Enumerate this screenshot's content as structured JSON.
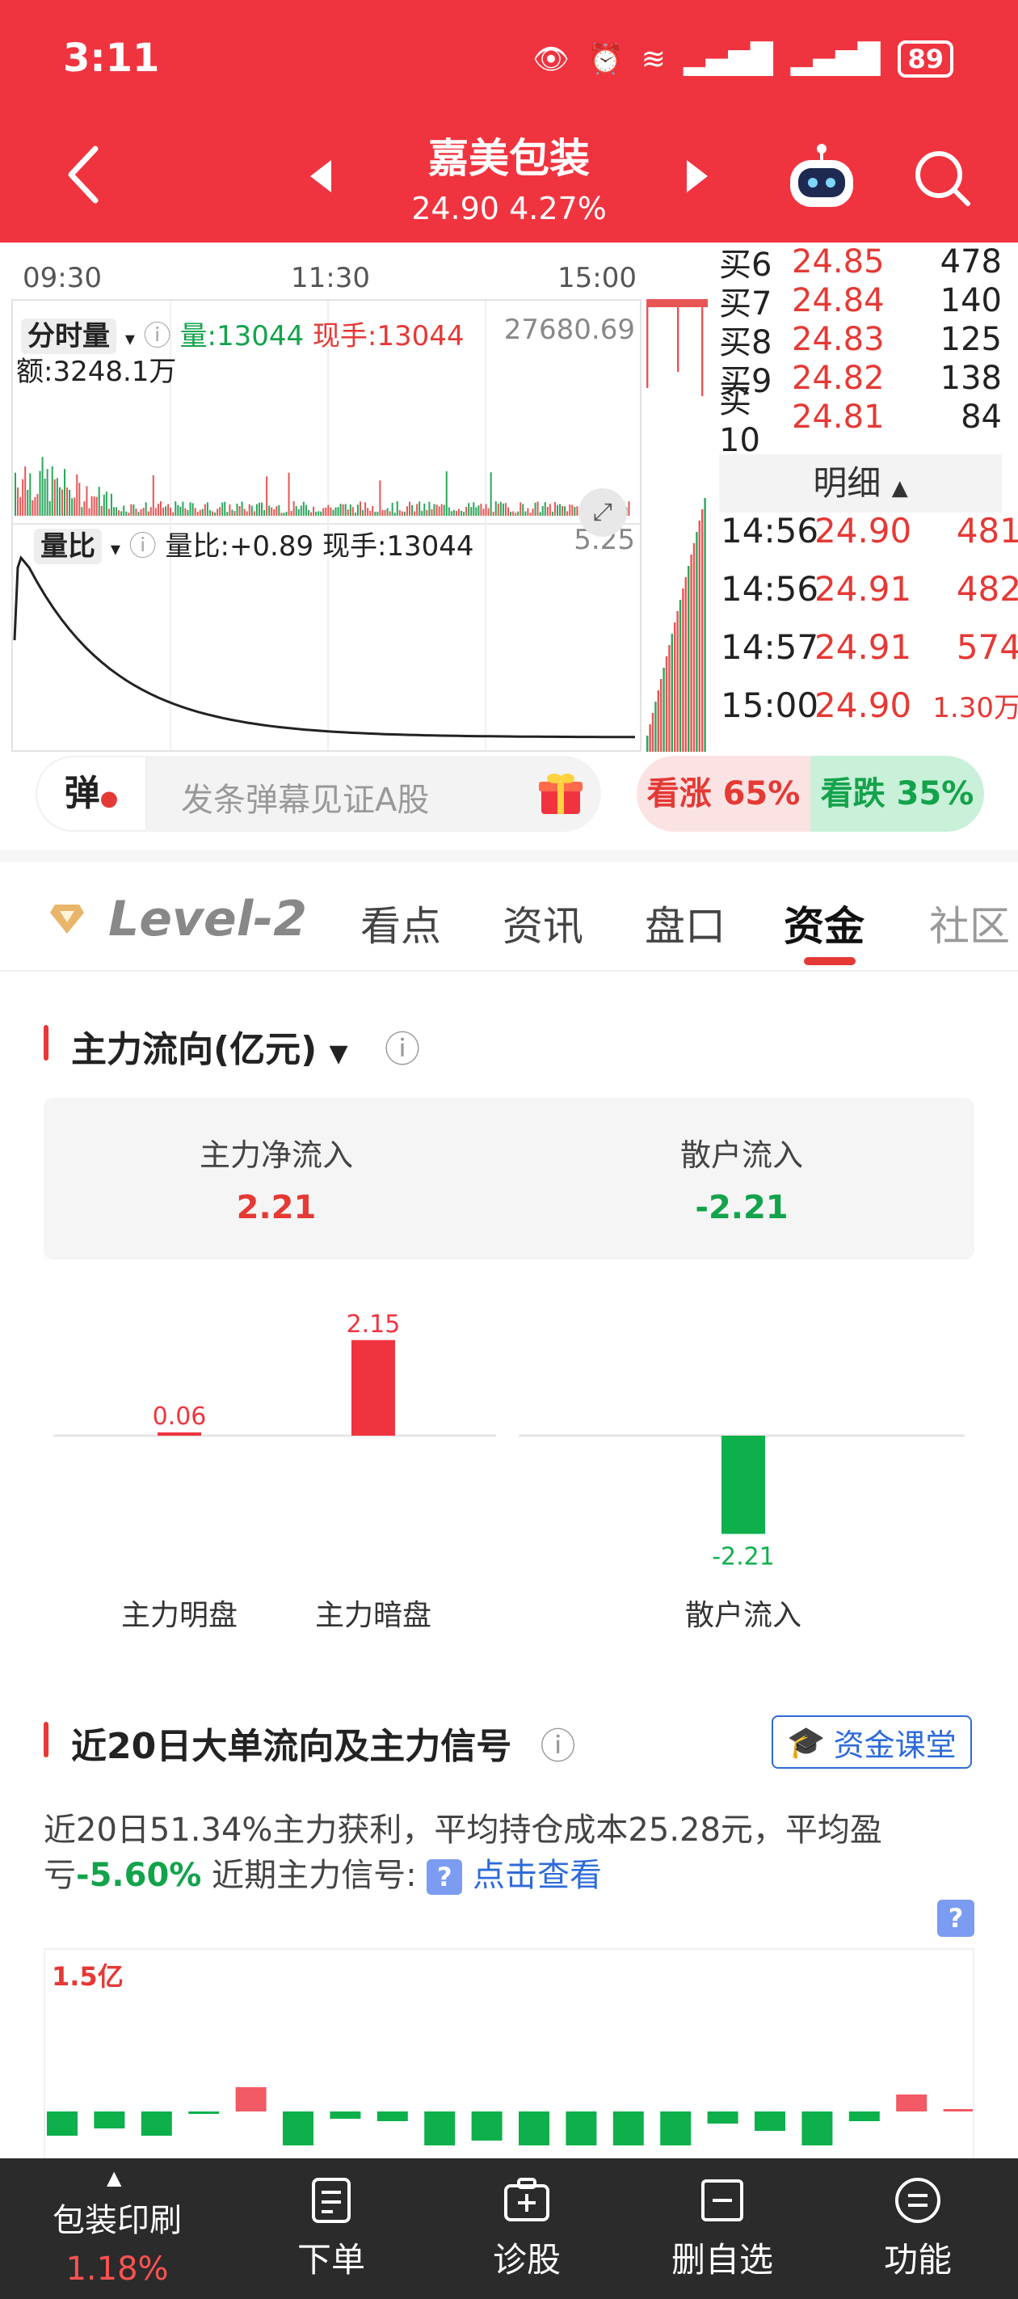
{
  "status": {
    "time": "3:11",
    "battery": "89"
  },
  "header": {
    "stock_name": "嘉美包装",
    "price": "24.90",
    "change_pct": "4.27%"
  },
  "chart": {
    "times": [
      "09:30",
      "11:30",
      "15:00"
    ],
    "minute_volume_label": "分时量",
    "volume_text": "量:13044",
    "current_hand_text": "现手:13044",
    "max_value": "27680.69",
    "amount_text": "额:3248.1万",
    "volume_ratio_label": "量比",
    "volume_ratio_text": "量比:+0.89",
    "vr_hand_text": "现手:13044",
    "vr_max": "5.25"
  },
  "orderbook": [
    {
      "label": "买6",
      "price": "24.85",
      "volume": "478"
    },
    {
      "label": "买7",
      "price": "24.84",
      "volume": "140"
    },
    {
      "label": "买8",
      "price": "24.83",
      "volume": "125"
    },
    {
      "label": "买9",
      "price": "24.82",
      "volume": "138"
    },
    {
      "label": "买10",
      "price": "24.81",
      "volume": "84"
    }
  ],
  "detail": {
    "header": "明细",
    "ticks": [
      {
        "time": "14:56",
        "price": "24.90",
        "volume": "481"
      },
      {
        "time": "14:56",
        "price": "24.91",
        "volume": "482"
      },
      {
        "time": "14:57",
        "price": "24.91",
        "volume": "574"
      },
      {
        "time": "15:00",
        "price": "24.90",
        "volume": "1.30万"
      }
    ]
  },
  "danmaku": {
    "icon_label": "弹",
    "placeholder": "发条弹幕见证A股"
  },
  "sentiment": {
    "bull": "看涨 65%",
    "bear": "看跌 35%"
  },
  "tabs": {
    "level2": "Level-2",
    "items": [
      "看点",
      "资讯",
      "盘口",
      "资金",
      "社区"
    ],
    "active": "资金"
  },
  "main_flow": {
    "title": "主力流向(亿元)",
    "net_inflow_label": "主力净流入",
    "net_inflow_value": "2.21",
    "retail_inflow_label": "散户流入",
    "retail_inflow_value": "-2.21"
  },
  "chart_data": {
    "type": "bar",
    "categories": [
      "主力明盘",
      "主力暗盘",
      "散户流入"
    ],
    "values": [
      0.06,
      2.15,
      -2.21
    ],
    "value_labels": [
      "0.06",
      "2.15",
      "-2.21"
    ],
    "colors": [
      "#f0343f",
      "#f0343f",
      "#0db04b"
    ]
  },
  "signal_section": {
    "title": "近20日大单流向及主力信号",
    "course_button": "资金课堂",
    "summary_pre": "近20日51.34%主力获利，平均持仓成本25.28元，平均盈亏",
    "summary_pct": "-5.60%",
    "summary_mid": " 近期主力信号:",
    "summary_link": "点击查看",
    "top_label": "1.5亿",
    "bars": [
      -0.5,
      -0.35,
      -0.5,
      -0.05,
      0.5,
      -0.7,
      -0.15,
      -0.2,
      -0.7,
      -0.6,
      -0.7,
      -0.7,
      -0.7,
      -0.7,
      -0.25,
      -0.4,
      -0.7,
      -0.2,
      0.35,
      0.05
    ]
  },
  "bottom_nav": {
    "sector_name": "包装印刷",
    "sector_pct": "1.18%",
    "items": [
      "下单",
      "诊股",
      "删自选",
      "功能"
    ]
  }
}
